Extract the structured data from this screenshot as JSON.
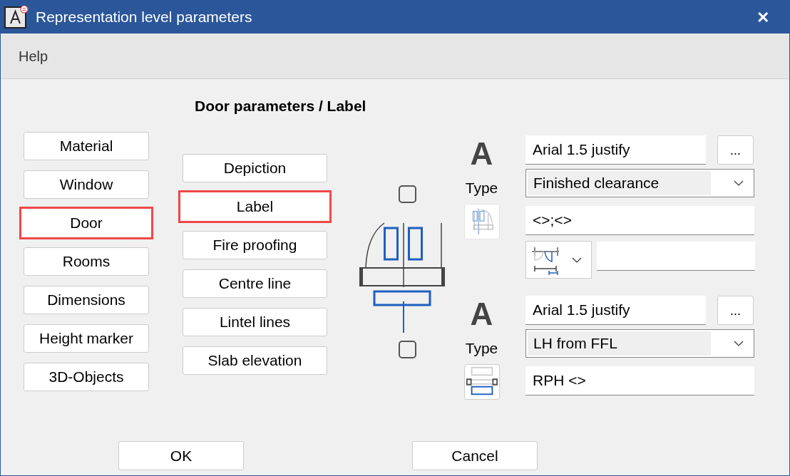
{
  "window": {
    "title": "Representation level parameters",
    "close": "✕"
  },
  "menu": [
    "Help"
  ],
  "heading": "Door parameters / Label",
  "categories": [
    {
      "label": "Material",
      "selected": false
    },
    {
      "label": "Window",
      "selected": false
    },
    {
      "label": "Door",
      "selected": true
    },
    {
      "label": "Rooms",
      "selected": false
    },
    {
      "label": "Dimensions",
      "selected": false
    },
    {
      "label": "Height marker",
      "selected": false
    },
    {
      "label": "3D-Objects",
      "selected": false
    }
  ],
  "subcategories": [
    {
      "label": "Depiction",
      "selected": false
    },
    {
      "label": "Label",
      "selected": true
    },
    {
      "label": "Fire proofing",
      "selected": false
    },
    {
      "label": "Centre line",
      "selected": false
    },
    {
      "label": "Lintel lines",
      "selected": false
    },
    {
      "label": "Slab elevation",
      "selected": false
    }
  ],
  "diagram": {
    "checkboxes": [
      {
        "checked": false
      },
      {
        "checked": false
      }
    ]
  },
  "groups": [
    {
      "kind": "opening",
      "glyph": "A",
      "type_label": "Type",
      "font": "Arial 1.5 justify",
      "font_button": "...",
      "type_value": "Finished clearance",
      "text": "<>;<>"
    },
    {
      "kind": "height",
      "glyph": "A",
      "type_label": "Type",
      "font": "Arial 1.5 justify",
      "font_button": "...",
      "type_value": "LH from FFL",
      "text": "RPH <>"
    }
  ],
  "buttons": [
    "OK",
    "Cancel"
  ]
}
